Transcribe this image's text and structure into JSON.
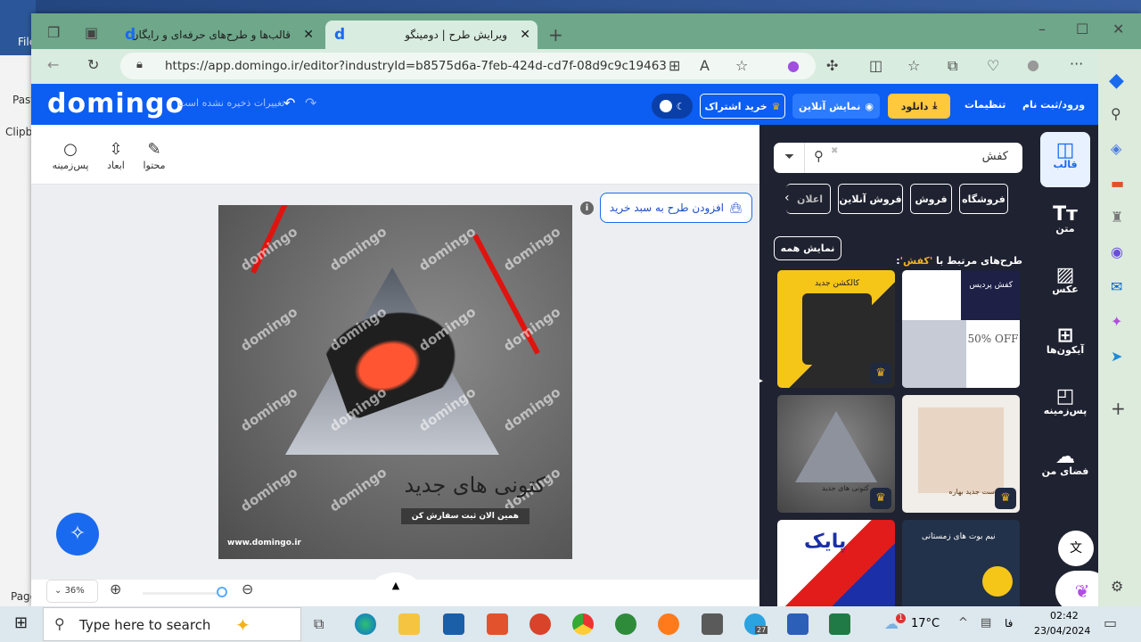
{
  "word": {
    "file": "File",
    "paste": "Past",
    "clipboard": "Clipbo",
    "page": "Page"
  },
  "browser": {
    "tabs": [
      {
        "label": "قالب‌ها و طرح‌های حرفه‌ای و رایگان",
        "active": false
      },
      {
        "label": "ویرایش طرح | دومینگو",
        "active": true
      }
    ],
    "url": "https://app.domingo.ir/editor?industryId=b8575d6a-7feb-424d-cd7f-08d9c9c19463"
  },
  "header": {
    "brand": "domingo",
    "unsaved": "تغییرات ذخیره نشده است",
    "subscribe": "خرید اشتراک",
    "preview": "نمایش آنلاین",
    "download": "دانلود",
    "settings": "تنظیمات",
    "login": "ورود/ثبت نام"
  },
  "toolbar": {
    "items": [
      {
        "label": "پس‌زمینه",
        "icon": "background-circle-icon"
      },
      {
        "label": "ابعاد",
        "icon": "resize-icon"
      },
      {
        "label": "محتوا",
        "icon": "edit-icon"
      }
    ]
  },
  "canvas": {
    "add_to_cart": "افزودن طرح به سبد خرید",
    "design": {
      "watermark": "domingo",
      "title": "کتونی های جدید",
      "subtitle": "همین الان ثبت سفارش کن",
      "site": "www.domingo.ir"
    }
  },
  "bottom": {
    "zoom": "36%"
  },
  "panel": {
    "search_value": "کفش",
    "chips": [
      "فروشگاه",
      "فروش",
      "فروش آنلاین",
      "اعلان"
    ],
    "related_prefix": "طرح‌های مرتبط با",
    "related_term": "'کفش'",
    "related_suffix": ":",
    "show_all": "نمایش همه",
    "templates": [
      {
        "text": "کفش پردیس",
        "extra": "50% OFF"
      },
      {
        "text": "کالکشن جدید"
      },
      {
        "text": "ست جدید بهاره"
      },
      {
        "text": "کتونی های جدید"
      },
      {
        "text": "نیم بوت های زمستانی"
      },
      {
        "text": "پایک"
      }
    ]
  },
  "rail": {
    "items": [
      {
        "label": "قالب",
        "icon": "template-icon",
        "active": true
      },
      {
        "label": "متن",
        "icon": "text-icon"
      },
      {
        "label": "عکس",
        "icon": "image-icon"
      },
      {
        "label": "آیکون‌ها",
        "icon": "icons-grid-icon"
      },
      {
        "label": "پس‌زمینه",
        "icon": "background-icon"
      },
      {
        "label": "فضای من",
        "icon": "upload-cloud-icon"
      }
    ]
  },
  "taskbar": {
    "search_placeholder": "Type here to search",
    "weather": "17°C",
    "lang": "فا",
    "time": "02:42",
    "date": "23/04/2024",
    "telegram_badge": "27",
    "weather_badge": "1"
  },
  "colors": {
    "brand_blue": "#0c5df2",
    "panel_dark": "#1f2230",
    "download_yellow": "#ffc83d",
    "accent_orange": "#f2b21c"
  }
}
